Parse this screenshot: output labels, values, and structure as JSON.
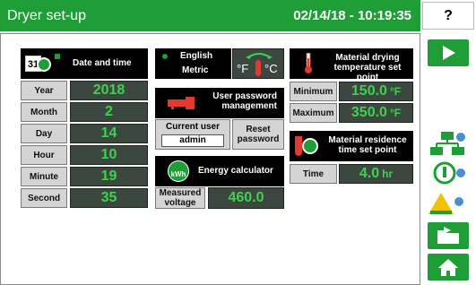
{
  "header": {
    "title": "Dryer set-up",
    "datetime": "02/14/18 - 10:19:35",
    "help_label": "?"
  },
  "date_time": {
    "icon_day": "31",
    "title": "Date and time",
    "rows": [
      {
        "label": "Year",
        "value": "2018"
      },
      {
        "label": "Month",
        "value": "2"
      },
      {
        "label": "Day",
        "value": "14"
      },
      {
        "label": "Hour",
        "value": "10"
      },
      {
        "label": "Minute",
        "value": "19"
      },
      {
        "label": "Second",
        "value": "35"
      }
    ]
  },
  "units": {
    "english": "English",
    "metric": "Metric",
    "f_label": "°F",
    "c_label": "°C"
  },
  "password": {
    "title": "User password management",
    "current_user_label": "Current user",
    "current_user": "admin",
    "reset_label": "Reset password"
  },
  "energy": {
    "title": "Energy calculator",
    "icon_text": "kWh",
    "measured_voltage_label": "Measured voltage",
    "measured_voltage": "460.0"
  },
  "drying_temp": {
    "title": "Material drying temperature set point",
    "min_label": "Minimum",
    "min_value": "150.0",
    "max_label": "Maximum",
    "max_value": "350.0",
    "unit": "°F"
  },
  "residence": {
    "title": "Material residence time set point",
    "time_label": "Time",
    "time_value": "4.0",
    "unit": "hr"
  },
  "colors": {
    "accent_green": "#1f9e38",
    "value_green": "#3ed24e",
    "value_bg": "#3c4740",
    "warning_yellow": "#f2c200"
  }
}
